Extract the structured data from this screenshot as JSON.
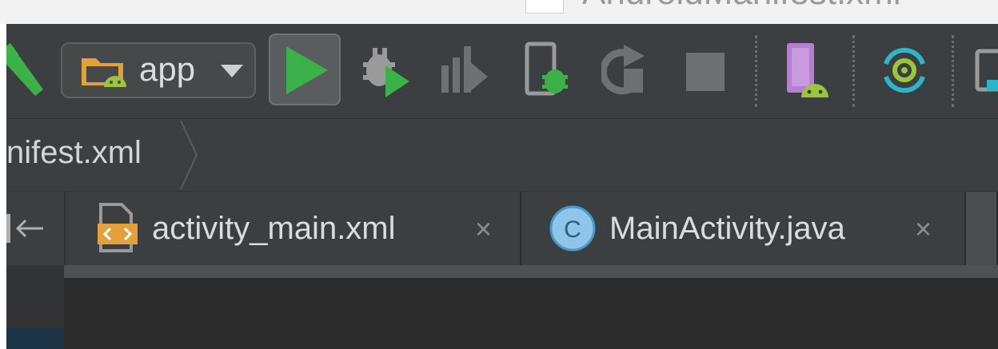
{
  "titlebar": {
    "title": "AndroidManifest.xml"
  },
  "toolbar": {
    "config_label": "app",
    "buttons": [
      {
        "name": "make-project",
        "icon": "hammer-icon"
      },
      {
        "name": "run",
        "icon": "play-icon"
      },
      {
        "name": "debug",
        "icon": "bug-play-icon"
      },
      {
        "name": "profile",
        "icon": "profile-icon"
      },
      {
        "name": "attach-debugger",
        "icon": "device-bug-icon"
      },
      {
        "name": "apply-changes",
        "icon": "rerun-icon"
      },
      {
        "name": "stop",
        "icon": "stop-icon"
      },
      {
        "name": "avd-manager",
        "icon": "avd-icon"
      },
      {
        "name": "sync",
        "icon": "sync-icon"
      }
    ]
  },
  "navbar": {
    "breadcrumb": "nifest.xml"
  },
  "tabs": [
    {
      "label": "activity_main.xml",
      "close": "×",
      "icon": "xml-file-icon"
    },
    {
      "label": "MainActivity.java",
      "close": "×",
      "icon": "java-class-icon"
    }
  ],
  "colors": {
    "run_green": "#3cb14a",
    "folder_orange": "#e2a13a",
    "android_green": "#9bc63b",
    "avd_purple": "#b77fd1",
    "sync_teal": "#2db6c9"
  }
}
